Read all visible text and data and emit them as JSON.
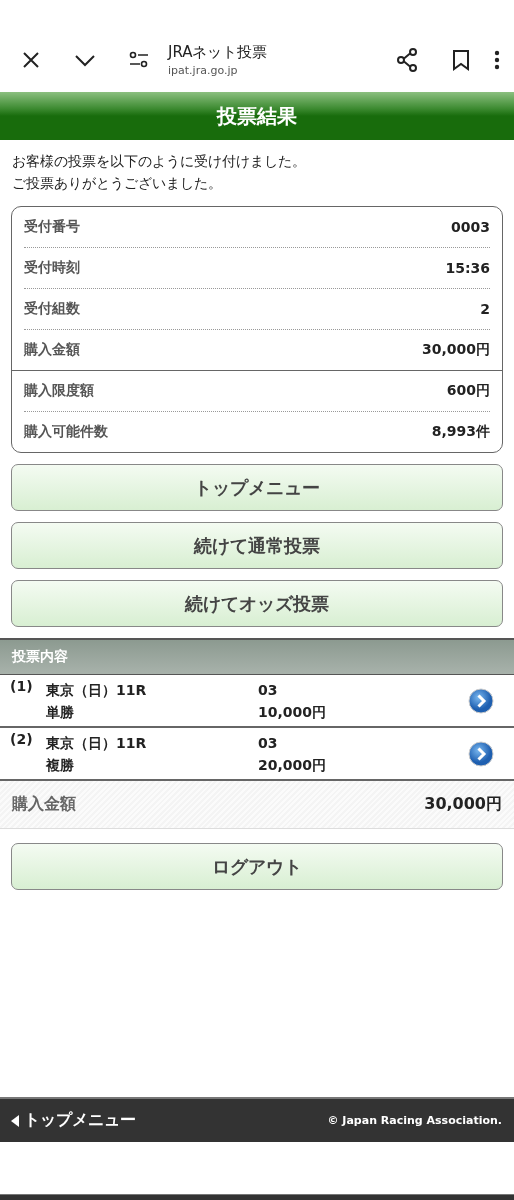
{
  "browser": {
    "title": "JRAネット投票",
    "url": "ipat.jra.go.jp"
  },
  "header": {
    "title": "投票結果"
  },
  "message": [
    "お客様の投票を以下のように受け付けました。",
    "ご投票ありがとうございました。"
  ],
  "summary": [
    {
      "label": "受付番号",
      "value": "0003"
    },
    {
      "label": "受付時刻",
      "value": "15:36"
    },
    {
      "label": "受付組数",
      "value": "2"
    },
    {
      "label": "購入金額",
      "value": "30,000円"
    }
  ],
  "limits": [
    {
      "label": "購入限度額",
      "value": "600円"
    },
    {
      "label": "購入可能件数",
      "value": "8,993件"
    }
  ],
  "buttons": [
    "トップメニュー",
    "続けて通常投票",
    "続けてオッズ投票"
  ],
  "bets_section": {
    "title": "投票内容",
    "rows": [
      {
        "number": "(1)",
        "race": "東京（日）11R",
        "type": "単勝",
        "selection": "03",
        "amount": "10,000円"
      },
      {
        "number": "(2)",
        "race": "東京（日）11R",
        "type": "複勝",
        "selection": "03",
        "amount": "20,000円"
      }
    ],
    "total_label": "購入金額",
    "total_value": "30,000円"
  },
  "logout": "ログアウト",
  "footer": {
    "link": "トップメニュー",
    "copyright": "© Japan Racing Association."
  }
}
